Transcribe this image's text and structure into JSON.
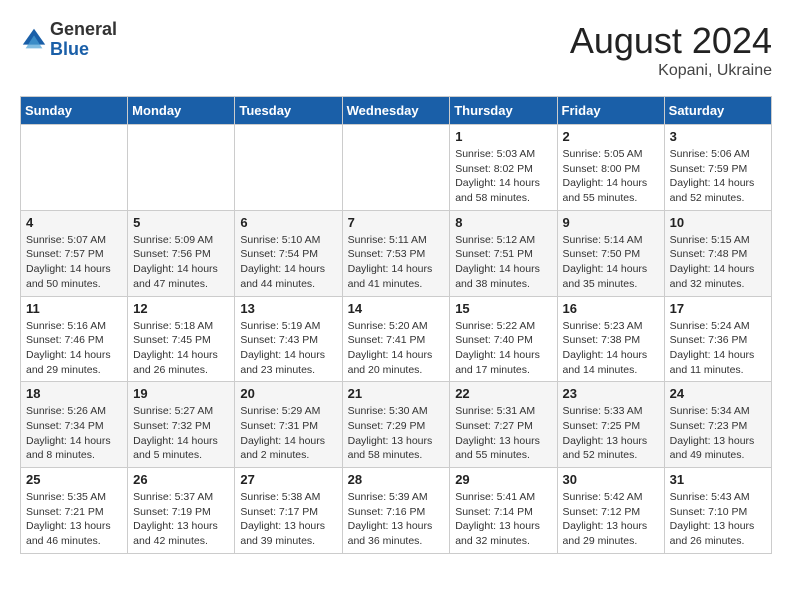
{
  "header": {
    "logo_general": "General",
    "logo_blue": "Blue",
    "month_year": "August 2024",
    "location": "Kopani, Ukraine"
  },
  "days_of_week": [
    "Sunday",
    "Monday",
    "Tuesday",
    "Wednesday",
    "Thursday",
    "Friday",
    "Saturday"
  ],
  "weeks": [
    [
      {
        "day": "",
        "info": ""
      },
      {
        "day": "",
        "info": ""
      },
      {
        "day": "",
        "info": ""
      },
      {
        "day": "",
        "info": ""
      },
      {
        "day": "1",
        "info": "Sunrise: 5:03 AM\nSunset: 8:02 PM\nDaylight: 14 hours\nand 58 minutes."
      },
      {
        "day": "2",
        "info": "Sunrise: 5:05 AM\nSunset: 8:00 PM\nDaylight: 14 hours\nand 55 minutes."
      },
      {
        "day": "3",
        "info": "Sunrise: 5:06 AM\nSunset: 7:59 PM\nDaylight: 14 hours\nand 52 minutes."
      }
    ],
    [
      {
        "day": "4",
        "info": "Sunrise: 5:07 AM\nSunset: 7:57 PM\nDaylight: 14 hours\nand 50 minutes."
      },
      {
        "day": "5",
        "info": "Sunrise: 5:09 AM\nSunset: 7:56 PM\nDaylight: 14 hours\nand 47 minutes."
      },
      {
        "day": "6",
        "info": "Sunrise: 5:10 AM\nSunset: 7:54 PM\nDaylight: 14 hours\nand 44 minutes."
      },
      {
        "day": "7",
        "info": "Sunrise: 5:11 AM\nSunset: 7:53 PM\nDaylight: 14 hours\nand 41 minutes."
      },
      {
        "day": "8",
        "info": "Sunrise: 5:12 AM\nSunset: 7:51 PM\nDaylight: 14 hours\nand 38 minutes."
      },
      {
        "day": "9",
        "info": "Sunrise: 5:14 AM\nSunset: 7:50 PM\nDaylight: 14 hours\nand 35 minutes."
      },
      {
        "day": "10",
        "info": "Sunrise: 5:15 AM\nSunset: 7:48 PM\nDaylight: 14 hours\nand 32 minutes."
      }
    ],
    [
      {
        "day": "11",
        "info": "Sunrise: 5:16 AM\nSunset: 7:46 PM\nDaylight: 14 hours\nand 29 minutes."
      },
      {
        "day": "12",
        "info": "Sunrise: 5:18 AM\nSunset: 7:45 PM\nDaylight: 14 hours\nand 26 minutes."
      },
      {
        "day": "13",
        "info": "Sunrise: 5:19 AM\nSunset: 7:43 PM\nDaylight: 14 hours\nand 23 minutes."
      },
      {
        "day": "14",
        "info": "Sunrise: 5:20 AM\nSunset: 7:41 PM\nDaylight: 14 hours\nand 20 minutes."
      },
      {
        "day": "15",
        "info": "Sunrise: 5:22 AM\nSunset: 7:40 PM\nDaylight: 14 hours\nand 17 minutes."
      },
      {
        "day": "16",
        "info": "Sunrise: 5:23 AM\nSunset: 7:38 PM\nDaylight: 14 hours\nand 14 minutes."
      },
      {
        "day": "17",
        "info": "Sunrise: 5:24 AM\nSunset: 7:36 PM\nDaylight: 14 hours\nand 11 minutes."
      }
    ],
    [
      {
        "day": "18",
        "info": "Sunrise: 5:26 AM\nSunset: 7:34 PM\nDaylight: 14 hours\nand 8 minutes."
      },
      {
        "day": "19",
        "info": "Sunrise: 5:27 AM\nSunset: 7:32 PM\nDaylight: 14 hours\nand 5 minutes."
      },
      {
        "day": "20",
        "info": "Sunrise: 5:29 AM\nSunset: 7:31 PM\nDaylight: 14 hours\nand 2 minutes."
      },
      {
        "day": "21",
        "info": "Sunrise: 5:30 AM\nSunset: 7:29 PM\nDaylight: 13 hours\nand 58 minutes."
      },
      {
        "day": "22",
        "info": "Sunrise: 5:31 AM\nSunset: 7:27 PM\nDaylight: 13 hours\nand 55 minutes."
      },
      {
        "day": "23",
        "info": "Sunrise: 5:33 AM\nSunset: 7:25 PM\nDaylight: 13 hours\nand 52 minutes."
      },
      {
        "day": "24",
        "info": "Sunrise: 5:34 AM\nSunset: 7:23 PM\nDaylight: 13 hours\nand 49 minutes."
      }
    ],
    [
      {
        "day": "25",
        "info": "Sunrise: 5:35 AM\nSunset: 7:21 PM\nDaylight: 13 hours\nand 46 minutes."
      },
      {
        "day": "26",
        "info": "Sunrise: 5:37 AM\nSunset: 7:19 PM\nDaylight: 13 hours\nand 42 minutes."
      },
      {
        "day": "27",
        "info": "Sunrise: 5:38 AM\nSunset: 7:17 PM\nDaylight: 13 hours\nand 39 minutes."
      },
      {
        "day": "28",
        "info": "Sunrise: 5:39 AM\nSunset: 7:16 PM\nDaylight: 13 hours\nand 36 minutes."
      },
      {
        "day": "29",
        "info": "Sunrise: 5:41 AM\nSunset: 7:14 PM\nDaylight: 13 hours\nand 32 minutes."
      },
      {
        "day": "30",
        "info": "Sunrise: 5:42 AM\nSunset: 7:12 PM\nDaylight: 13 hours\nand 29 minutes."
      },
      {
        "day": "31",
        "info": "Sunrise: 5:43 AM\nSunset: 7:10 PM\nDaylight: 13 hours\nand 26 minutes."
      }
    ]
  ]
}
